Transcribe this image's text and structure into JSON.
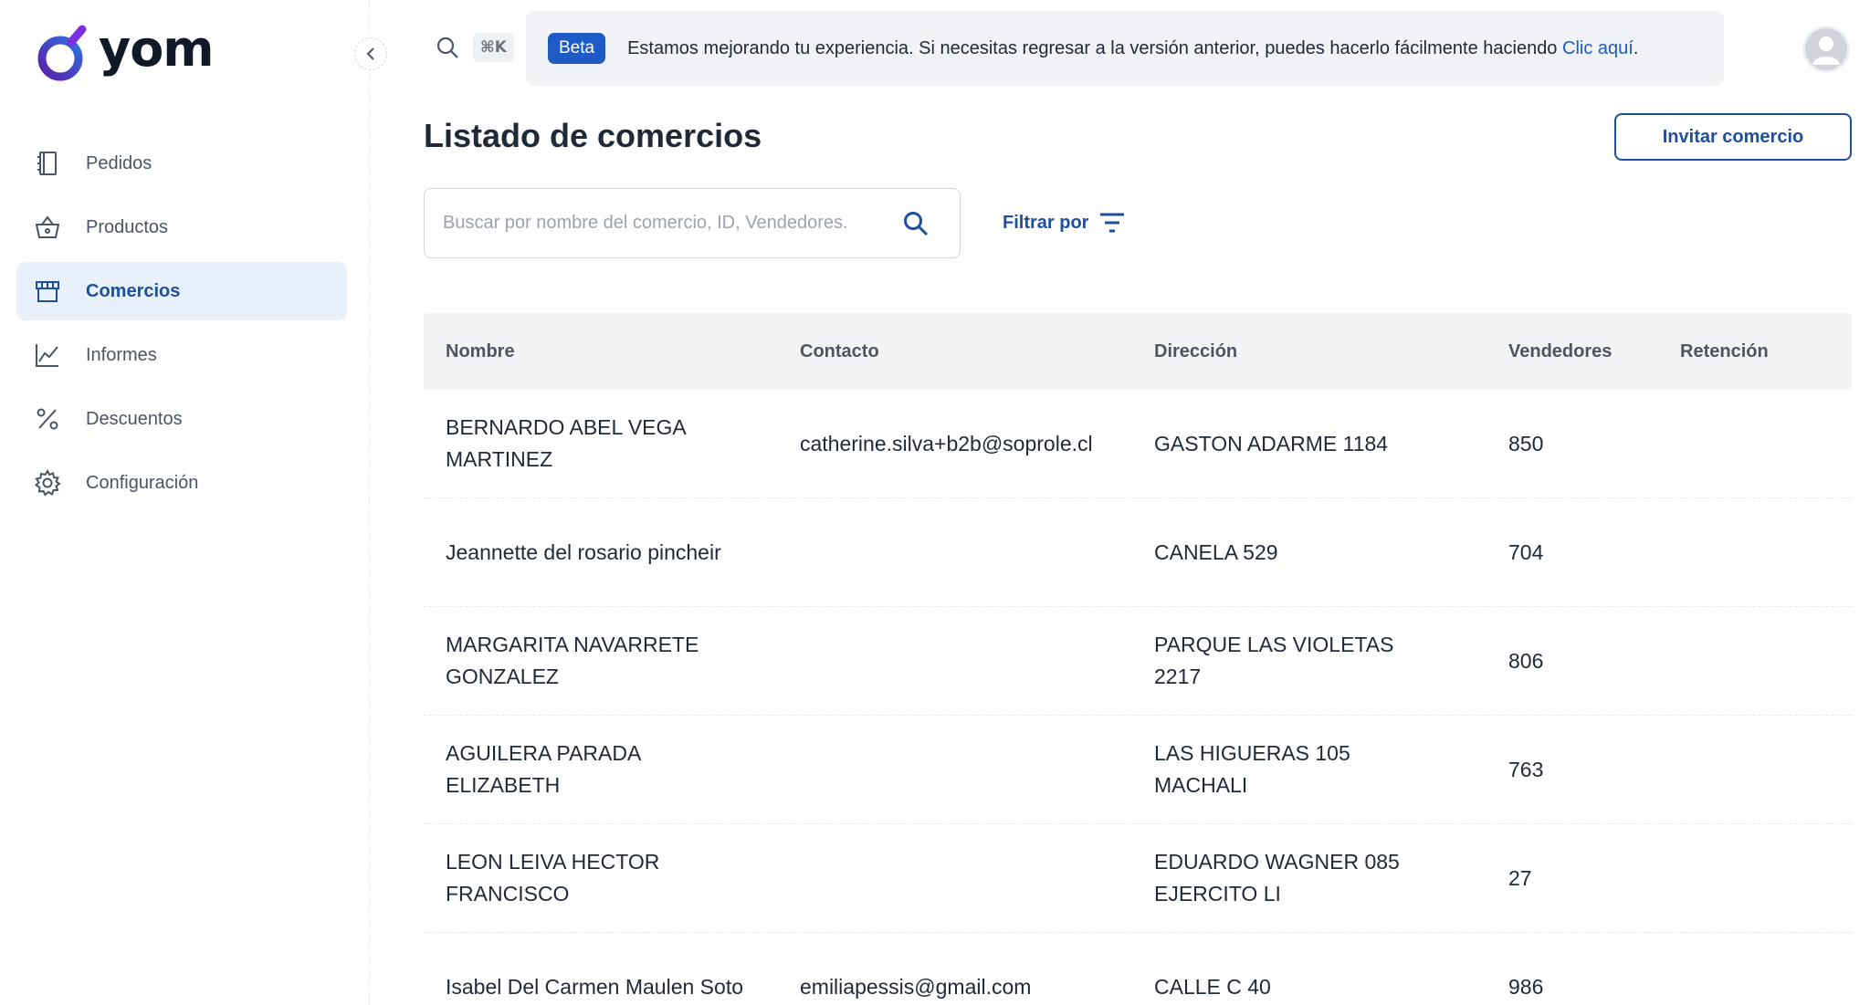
{
  "app": {
    "logo_text": "yom"
  },
  "sidebar": {
    "items": [
      {
        "label": "Pedidos",
        "icon": "notebook-icon",
        "active": false
      },
      {
        "label": "Productos",
        "icon": "basket-icon",
        "active": false
      },
      {
        "label": "Comercios",
        "icon": "store-icon",
        "active": true
      },
      {
        "label": "Informes",
        "icon": "chart-line-icon",
        "active": false
      },
      {
        "label": "Descuentos",
        "icon": "percent-icon",
        "active": false
      },
      {
        "label": "Configuración",
        "icon": "gear-icon",
        "active": false
      }
    ]
  },
  "topbar": {
    "shortcut": "⌘K",
    "banner": {
      "badge": "Beta",
      "text": "Estamos mejorando tu experiencia. Si necesitas regresar a la versión anterior, puedes hacerlo fácilmente haciendo ",
      "link": "Clic aquí",
      "suffix": "."
    }
  },
  "main": {
    "title": "Listado de comercios",
    "invite_label": "Invitar comercio",
    "search_placeholder": "Buscar por nombre del comercio, ID, Vendedores.",
    "filter_label": "Filtrar por"
  },
  "table": {
    "headers": [
      "Nombre",
      "Contacto",
      "Dirección",
      "Vendedores",
      "Retención"
    ],
    "rows": [
      [
        "BERNARDO ABEL VEGA MARTINEZ",
        "catherine.silva+b2b@soprole.cl",
        "GASTON ADARME 1184",
        "850",
        ""
      ],
      [
        "Jeannette del rosario pincheir",
        "",
        "CANELA 529",
        "704",
        ""
      ],
      [
        "MARGARITA NAVARRETE GONZALEZ",
        "",
        "PARQUE LAS VIOLETAS 2217",
        "806",
        ""
      ],
      [
        "AGUILERA PARADA ELIZABETH",
        "",
        "LAS HIGUERAS 105 MACHALI",
        "763",
        ""
      ],
      [
        "LEON LEIVA HECTOR FRANCISCO",
        "",
        "EDUARDO WAGNER 085 EJERCITO LI",
        "27",
        ""
      ],
      [
        "Isabel Del Carmen Maulen Soto",
        "emiliapessis@gmail.com",
        "CALLE C 40",
        "986",
        ""
      ]
    ]
  },
  "colors": {
    "accent": "#1e4f9c",
    "beta": "#1e5bc6",
    "active_bg": "#e8f0fb"
  }
}
